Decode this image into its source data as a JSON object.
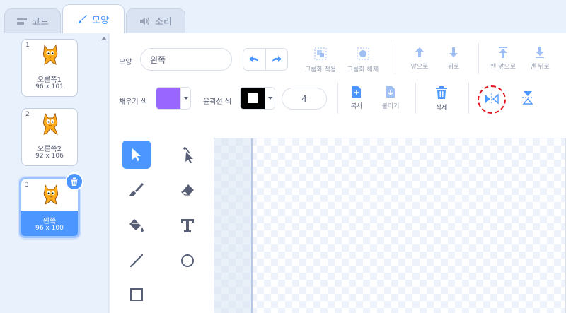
{
  "tabs": [
    {
      "label": "코드",
      "icon": "code-icon"
    },
    {
      "label": "모양",
      "icon": "brush-icon"
    },
    {
      "label": "소리",
      "icon": "sound-icon"
    }
  ],
  "costumes": [
    {
      "index": "1",
      "name": "오른쪽1",
      "size": "96 x 101"
    },
    {
      "index": "2",
      "name": "오른쪽2",
      "size": "92 x 106"
    },
    {
      "index": "3",
      "name": "왼쪽",
      "size": "96 x 100"
    }
  ],
  "editor": {
    "costume_label": "모양",
    "costume_name": "왼쪽",
    "fill_label": "채우기 색",
    "outline_label": "윤곽선 색",
    "stroke_width": "4",
    "fill_color": "#9966ff",
    "outline_color": "#000000",
    "buttons": {
      "group": "그룹화 적용",
      "ungroup": "그룹화 해제",
      "forward": "앞으로",
      "backward": "뒤로",
      "front": "맨 앞으로",
      "back": "맨 뒤로",
      "copy": "복사",
      "paste": "붙이기",
      "delete": "삭제"
    }
  },
  "colors": {
    "accent": "#4c97ff",
    "highlight": "#e1141c"
  }
}
